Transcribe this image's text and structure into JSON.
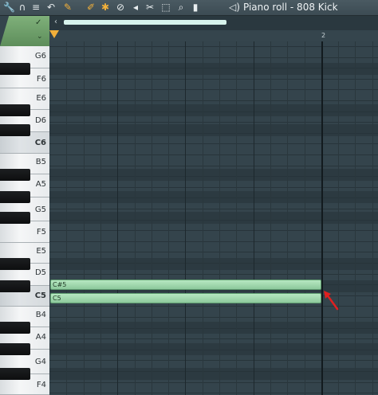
{
  "window": {
    "title": "Piano roll - 808 Kick"
  },
  "toolbar": {
    "icons": [
      {
        "name": "wrench-icon",
        "glyph": "🔧"
      },
      {
        "name": "magnet-icon",
        "glyph": "∩"
      },
      {
        "name": "menu-circle-icon",
        "glyph": "≡"
      },
      {
        "name": "undo-icon",
        "glyph": "↶"
      },
      {
        "name": "pencil-icon",
        "glyph": "✎"
      },
      {
        "name": "paint-brush-icon",
        "glyph": "✐"
      },
      {
        "name": "magic-wand-icon",
        "glyph": "✱"
      },
      {
        "name": "delete-icon",
        "glyph": "⊘"
      },
      {
        "name": "mute-icon",
        "glyph": "◂"
      },
      {
        "name": "slice-icon",
        "glyph": "✂"
      },
      {
        "name": "select-icon",
        "glyph": "⬚"
      },
      {
        "name": "zoom-icon",
        "glyph": "⌕"
      },
      {
        "name": "playback-icon",
        "glyph": "▮"
      }
    ],
    "speaker_icon": "speaker-icon"
  },
  "ruler": {
    "bar_2_label": "2"
  },
  "keyboard": {
    "labels": [
      "G6",
      "F6",
      "E6",
      "D6",
      "C6",
      "B5",
      "A5",
      "G5",
      "F5",
      "E5",
      "D5",
      "C5",
      "B4",
      "A4",
      "G4",
      "F4"
    ]
  },
  "notes": [
    {
      "label": "C#5",
      "pitch": "C#5",
      "start_beats": 0,
      "length_beats": 4
    },
    {
      "label": "C5",
      "pitch": "C5",
      "start_beats": 0,
      "length_beats": 4
    }
  ],
  "colors": {
    "note_fill": "#a6dcb3",
    "accent": "#f2b03a",
    "annotation_arrow": "#e02020"
  }
}
